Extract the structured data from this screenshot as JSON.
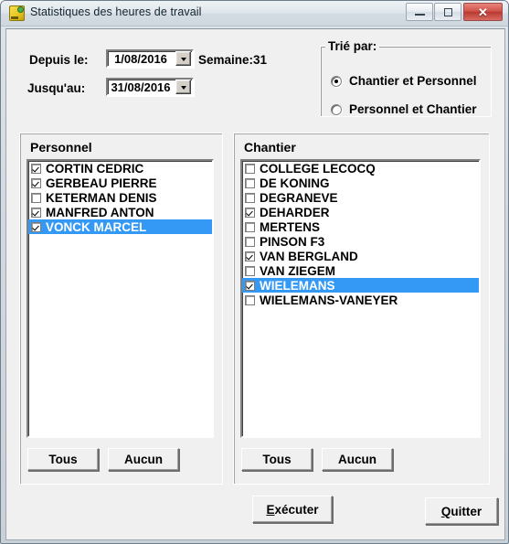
{
  "window": {
    "title": "Statistiques des heures de travail",
    "icon": "app-icon",
    "controls": {
      "minimize": "minimize-icon",
      "maximize": "maximize-icon",
      "close": "✕"
    },
    "close_color": "#c0392b"
  },
  "form": {
    "depuis_label": "Depuis le:",
    "depuis_value": "1/08/2016",
    "jusqu_label": "Jusqu'au:",
    "jusqu_value": "31/08/2016",
    "semaine_text": "Semaine:31"
  },
  "sort_group": {
    "title": "Trié par:",
    "options": [
      {
        "label": "Chantier et Personnel",
        "selected": true
      },
      {
        "label": "Personnel et Chantier",
        "selected": false
      }
    ]
  },
  "personnel_panel": {
    "title": "Personnel",
    "items": [
      {
        "label": "CORTIN CEDRIC",
        "checked": true,
        "selected": false
      },
      {
        "label": "GERBEAU PIERRE",
        "checked": true,
        "selected": false
      },
      {
        "label": "KETERMAN DENIS",
        "checked": false,
        "selected": false
      },
      {
        "label": "MANFRED ANTON",
        "checked": true,
        "selected": false
      },
      {
        "label": "VONCK MARCEL",
        "checked": true,
        "selected": true
      }
    ],
    "select_all_label": "Tous",
    "select_none_label": "Aucun"
  },
  "chantier_panel": {
    "title": "Chantier",
    "items": [
      {
        "label": "COLLEGE LECOCQ",
        "checked": false,
        "selected": false
      },
      {
        "label": "DE KONING",
        "checked": false,
        "selected": false
      },
      {
        "label": "DEGRANEVE",
        "checked": false,
        "selected": false
      },
      {
        "label": "DEHARDER",
        "checked": true,
        "selected": false
      },
      {
        "label": "MERTENS",
        "checked": false,
        "selected": false
      },
      {
        "label": "PINSON F3",
        "checked": false,
        "selected": false
      },
      {
        "label": "VAN BERGLAND",
        "checked": true,
        "selected": false
      },
      {
        "label": "VAN ZIEGEM",
        "checked": false,
        "selected": false
      },
      {
        "label": "WIELEMANS",
        "checked": true,
        "selected": true
      },
      {
        "label": "WIELEMANS-VANEYER",
        "checked": false,
        "selected": false
      }
    ],
    "select_all_label": "Tous",
    "select_none_label": "Aucun"
  },
  "actions": {
    "execute_label": "Exécuter",
    "execute_accesskey": "E",
    "quit_label": "Quitter",
    "quit_accesskey": "Q"
  },
  "colors": {
    "selection_blue": "#3399f5",
    "dialog_gray": "#f0f0f0",
    "listbox_white": "#ffffff"
  }
}
